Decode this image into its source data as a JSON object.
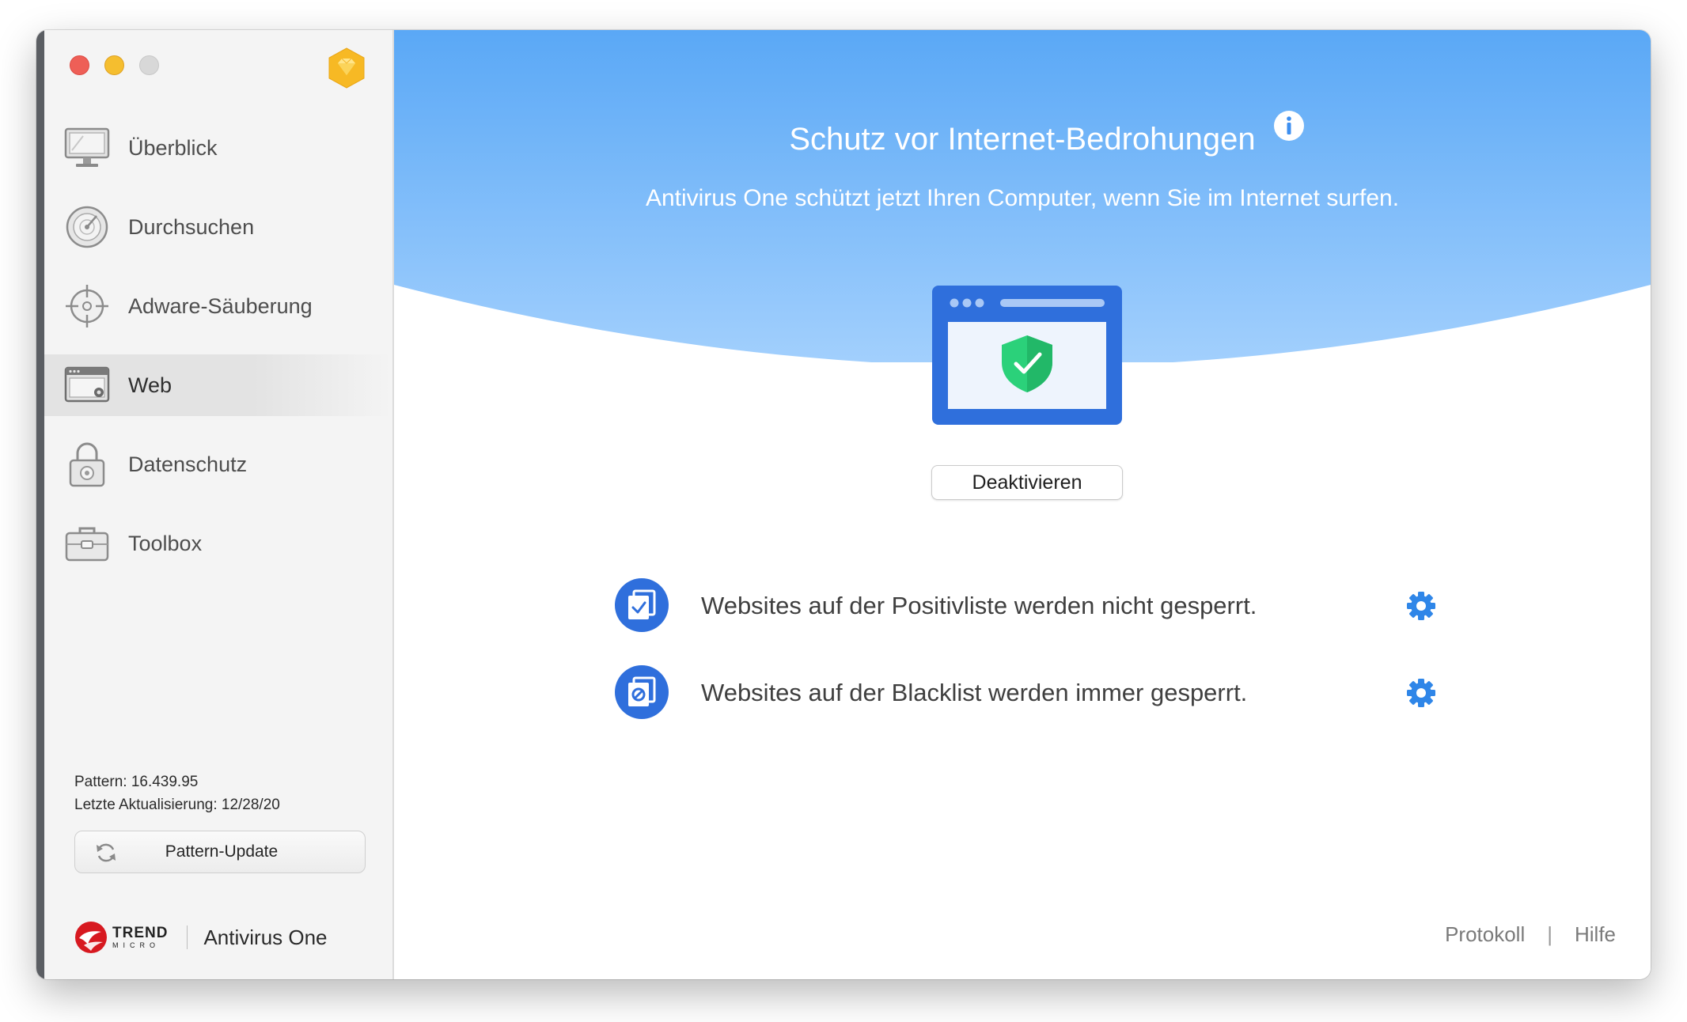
{
  "window": {
    "traffic_lights": [
      "close",
      "minimize",
      "zoom"
    ]
  },
  "sidebar": {
    "items": [
      {
        "label": "Überblick",
        "icon": "monitor-icon"
      },
      {
        "label": "Durchsuchen",
        "icon": "radar-icon"
      },
      {
        "label": "Adware-Säuberung",
        "icon": "crosshair-icon"
      },
      {
        "label": "Web",
        "icon": "browser-icon",
        "active": true
      },
      {
        "label": "Datenschutz",
        "icon": "lock-icon"
      },
      {
        "label": "Toolbox",
        "icon": "toolbox-icon"
      }
    ],
    "pattern_label": "Pattern: 16.439.95",
    "last_update_label": "Letzte Aktualisierung: 12/28/20",
    "update_button": "Pattern-Update",
    "brand_line1": "TREND",
    "brand_line2": "MICRO",
    "product_name": "Antivirus One"
  },
  "main": {
    "title": "Schutz vor Internet-Bedrohungen",
    "subtitle": "Antivirus One schützt jetzt Ihren Computer, wenn Sie im Internet surfen.",
    "deactivate_button": "Deaktivieren",
    "options": [
      {
        "text": "Websites auf der Positivliste werden nicht gesperrt.",
        "icon": "whitelist-icon"
      },
      {
        "text": "Websites auf der Blacklist werden immer gesperrt.",
        "icon": "blacklist-icon"
      }
    ],
    "footer": {
      "protokoll": "Protokoll",
      "separator": "|",
      "hilfe": "Hilfe"
    }
  },
  "colors": {
    "hero_top": "#5aa8f6",
    "hero_bottom": "#a3d0fd",
    "accent_blue": "#2f6fdc",
    "gear_blue": "#2f86e8",
    "shield_green": "#2bd17a",
    "trend_red": "#d71920"
  }
}
